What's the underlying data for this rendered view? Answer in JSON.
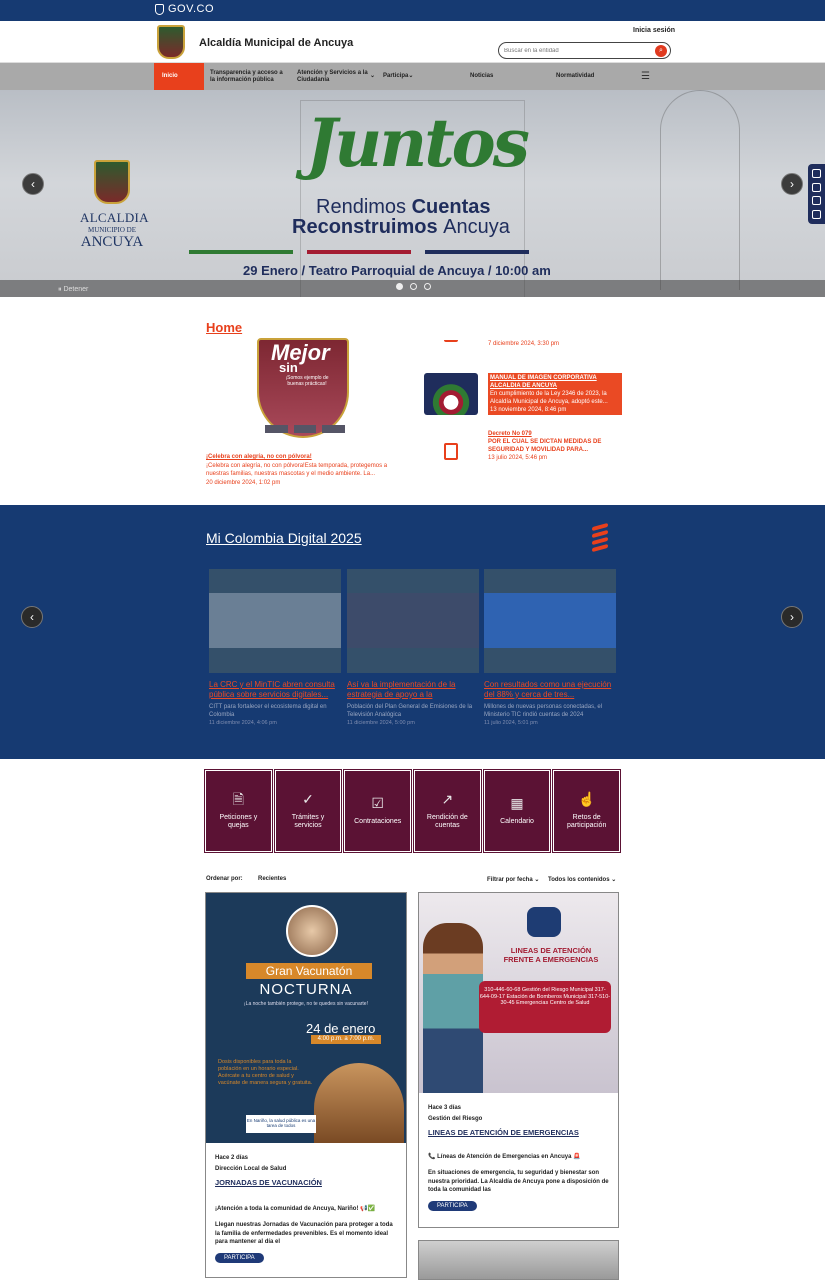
{
  "gov": {
    "label": "GOV.CO"
  },
  "header": {
    "title": "Alcaldía Municipal de Ancuya",
    "login": "Inicia sesión",
    "search_placeholder": "Buscar en la entidad"
  },
  "nav": {
    "items": [
      {
        "label": "Inicio"
      },
      {
        "label": "Transparencia y acceso a la información pública"
      },
      {
        "label": "Atención y Servicios a la Ciudadanía"
      },
      {
        "label": "Participa"
      },
      {
        "label": "Noticias"
      },
      {
        "label": "Normatividad"
      }
    ]
  },
  "hero": {
    "alcaldia": "ALCALDIA",
    "municipio": "MUNICIPIO DE",
    "ancuya": "ANCUYA",
    "juntos": "Juntos",
    "line1_a": "Rendimos ",
    "line1_b": "Cuentas",
    "line2_a": "Reconstruimos ",
    "line2_b": "Ancuya",
    "event": "29 Enero / Teatro Parroquial de Ancuya / 10:00 am",
    "pause": "Detener",
    "bar_colors": [
      "#2f7a33",
      "#a31c32",
      "#1f2d5c"
    ],
    "slides": 3,
    "active_slide": 1
  },
  "home": {
    "heading": "Home",
    "feature": {
      "img_word1": "Mejor",
      "img_word2": "sin",
      "img_caption": "¡Somos ejemplo de buenas prácticas!",
      "title": "¡Celebra con alegría, no con pólvora!",
      "desc": "¡Celebra con alegría, no con pólvora!Esta temporada, protegemos a nuestras familias, nuestras mascotas y el medio ambiente. La...",
      "date": "20 diciembre 2024, 1:02 pm"
    },
    "news": [
      {
        "title": "",
        "desc": "",
        "date": "7 diciembre 2024, 3:30 pm"
      },
      {
        "title": "MANUAL DE IMAGEN CORPORATIVA ALCALDIA DE ANCUYA",
        "desc": "En cumplimiento de la Ley 2346 de 2023, la Alcaldía Municipal de Ancuya, adoptó este...",
        "date": "13 noviembre 2024, 8:46 pm"
      },
      {
        "title": "Decreto No 079",
        "desc": "POR EL CUAL SE DICTAN MEDIDAS DE SEGURIDAD Y MOVILIDAD PARA...",
        "date": "13 julio 2024, 5:46 pm"
      }
    ]
  },
  "mcd": {
    "title": "Mi Colombia Digital 2025",
    "cards": [
      {
        "title": "La CRC y el MinTIC abren consulta pública sobre servicios digitales...",
        "desc": "CITT para fortalecer el ecosistema digital en Colombia",
        "date": "11 diciembre 2024, 4:06 pm",
        "color": "#6a7f95"
      },
      {
        "title": "Así va la implementación de la estrategia de apoyo a la",
        "desc": "Población del Plan General de Emisiones de la Televisión Analógica",
        "date": "11 diciembre 2024, 5:00 pm",
        "color": "#3d4b6a"
      },
      {
        "title": "Con resultados como una ejecución del 88% y cerca de tres...",
        "desc": "Millones de nuevas personas conectadas, el Ministerio TIC rindió cuentas de 2024",
        "date": "11 julio 2024, 5:01 pm",
        "color": "#2f63b2"
      }
    ]
  },
  "tiles": [
    {
      "label": "Peticiones y quejas",
      "icon": "document-icon"
    },
    {
      "label": "Trámites y servicios",
      "icon": "check-icon"
    },
    {
      "label": "Contrataciones",
      "icon": "checklist-icon"
    },
    {
      "label": "Rendición de cuentas",
      "icon": "chart-icon"
    },
    {
      "label": "Calendario",
      "icon": "calendar-icon"
    },
    {
      "label": "Retos de participación",
      "icon": "hand-icon"
    }
  ],
  "filters": {
    "sort_label": "Ordenar por:",
    "sort_value": "Recientes",
    "date_filter": "Filtrar por fecha",
    "content_filter": "Todos los contenidos"
  },
  "posts": [
    {
      "banner": "Gran Vacunatón",
      "banner2": "NOCTURNA",
      "sub": "¡La noche también protege, no te quedes sin vacunarte!",
      "date_big": "24 de enero",
      "hours": "4:00 p.m. a 7:00 p.m.",
      "body": "Dosis disponibles para toda la población en un horario especial. Acércate a tu centro de salud y vacúnate de manera segura y gratuita.",
      "badge": "En Nariño, la salud pública es una tarea de todos",
      "ago": "Hace 2 días",
      "category": "Dirección Local de Salud",
      "title": "JORNADAS DE VACUNACIÓN",
      "desc1": "¡Atención a toda la comunidad de Ancuya, Nariño! 📢✅",
      "desc2": "Llegan nuestras Jornadas de Vacunación para proteger a toda la familia de enfermedades prevenibles. Es el momento ideal para mantener al día el",
      "button": "PARTICIPA"
    },
    {
      "head": "LINEAS DE ATENCIÓN FRENTE A EMERGENCIAS",
      "box": "310-446-60-68 Gestión del Riesgo Municipal 317-644-09-17 Estación de Bomberos Municipal 317-510-30-45 Emergencias Centro de Salud",
      "ago": "Hace 3 días",
      "category": "Gestión del Riesgo",
      "title": "LINEAS DE ATENCIÓN DE EMERGENCIAS",
      "desc1": "📞 Líneas de Atención de Emergencias en Ancuya 🚨",
      "desc2": "En situaciones de emergencia, tu seguridad y bienestar son nuestra prioridad. La Alcaldía de Ancuya pone a disposición de toda la comunidad las",
      "button": "PARTICIPA"
    }
  ]
}
